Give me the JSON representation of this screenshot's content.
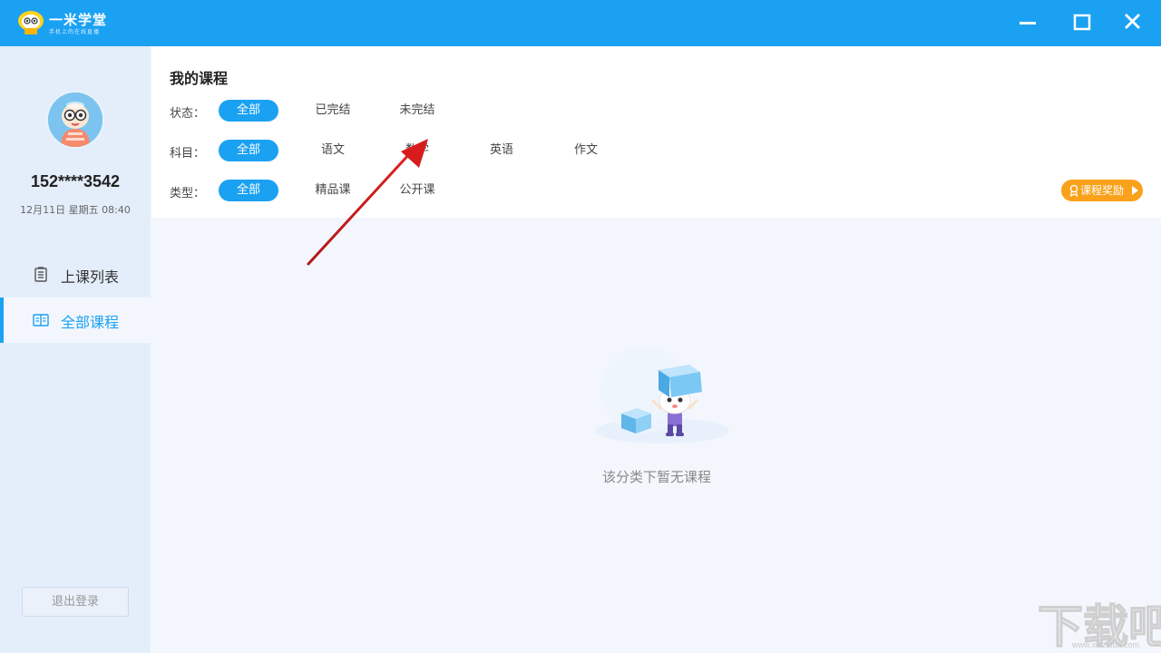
{
  "app": {
    "name": "一米学堂",
    "slogan": "手机上的在线直播",
    "icons": {
      "logo": "mascot-logo",
      "minimize": "minimize-icon",
      "maximize": "maximize-icon",
      "close": "close-icon"
    },
    "colors": {
      "accent": "#1ba1f2",
      "reward": "#f9a11b",
      "sidebar_bg": "#e4eefb"
    }
  },
  "sidebar": {
    "phone": "152****3542",
    "datetime": "12月11日 星期五 08:40",
    "items": [
      {
        "label": "上课列表",
        "icon": "list-icon",
        "active": false
      },
      {
        "label": "全部课程",
        "icon": "book-icon",
        "active": true
      }
    ],
    "logout_label": "退出登录"
  },
  "main": {
    "title": "我的课程",
    "filters": [
      {
        "label": "状态：",
        "options": [
          "全部",
          "已完结",
          "未完结"
        ],
        "selected": "全部"
      },
      {
        "label": "科目：",
        "options": [
          "全部",
          "语文",
          "数学",
          "英语",
          "作文"
        ],
        "selected": "全部"
      },
      {
        "label": "类型：",
        "options": [
          "全部",
          "精品课",
          "公开课"
        ],
        "selected": "全部"
      }
    ],
    "reward_label": "课程奖励",
    "empty_text": "该分类下暂无课程"
  },
  "watermark": {
    "text": "下载吧",
    "site": "www.xiazaiba.com"
  }
}
